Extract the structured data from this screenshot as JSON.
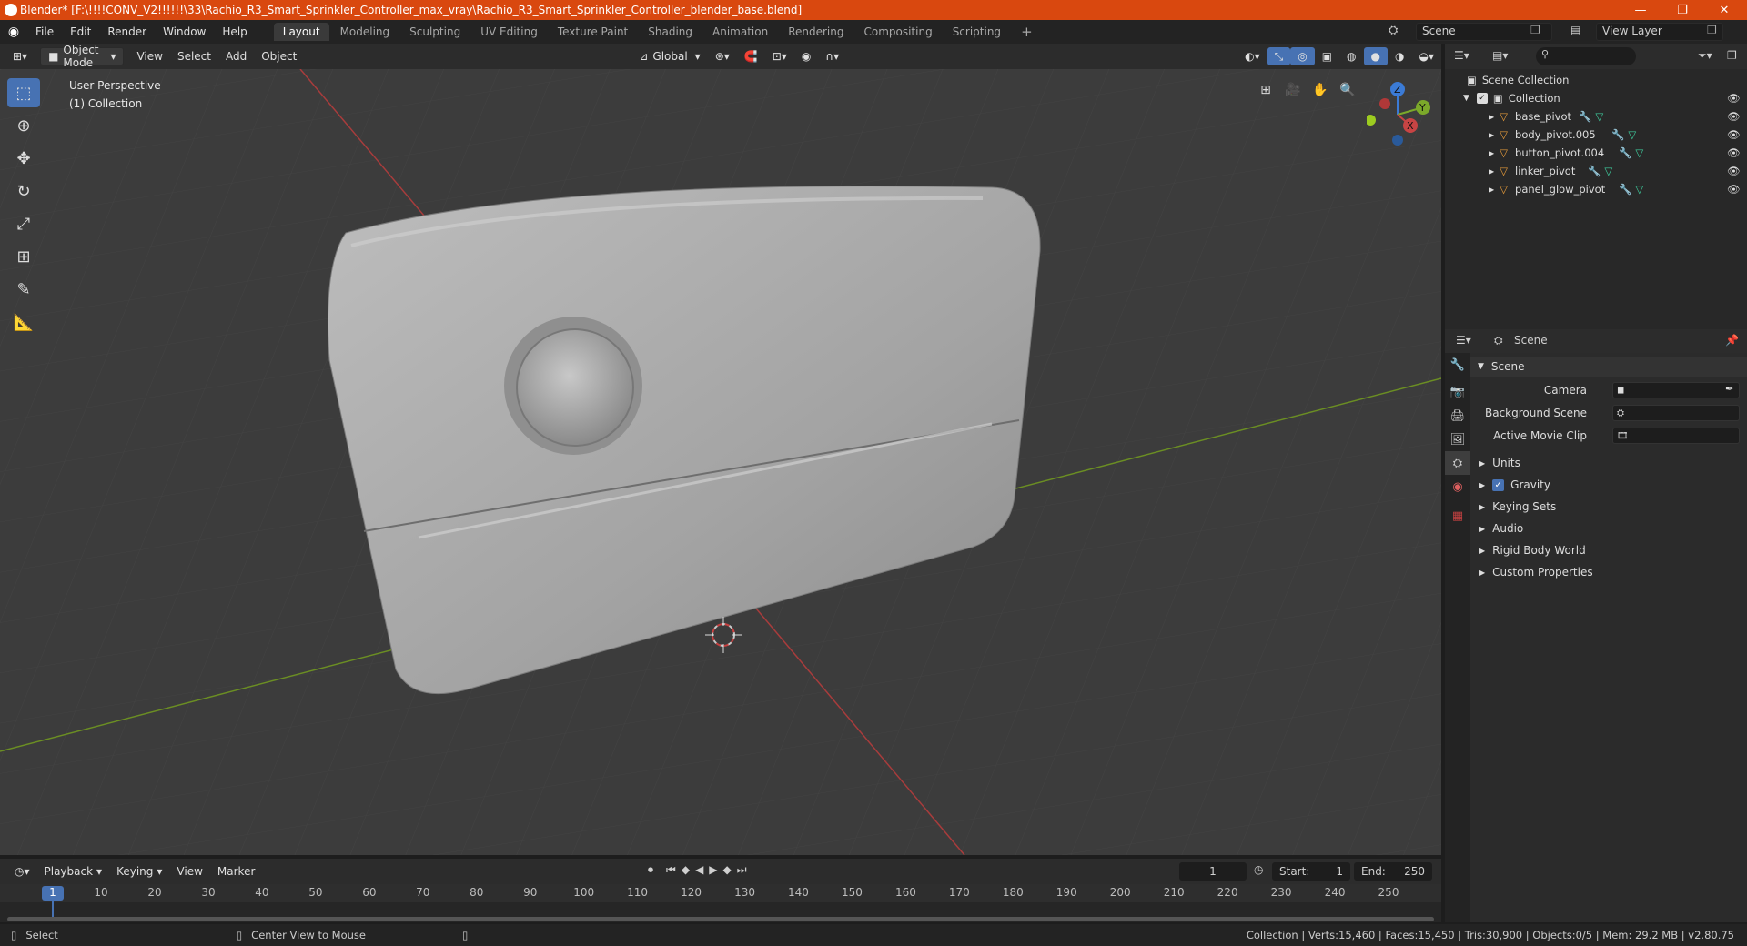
{
  "window": {
    "title": "Blender* [F:\\!!!!CONV_V2!!!!!!\\33\\Rachio_R3_Smart_Sprinkler_Controller_max_vray\\Rachio_R3_Smart_Sprinkler_Controller_blender_base.blend]",
    "minimize": "—",
    "restore": "❐",
    "close": "✕"
  },
  "menus": [
    "File",
    "Edit",
    "Render",
    "Window",
    "Help"
  ],
  "workspaces": [
    "Layout",
    "Modeling",
    "Sculpting",
    "UV Editing",
    "Texture Paint",
    "Shading",
    "Animation",
    "Rendering",
    "Compositing",
    "Scripting"
  ],
  "active_workspace": "Layout",
  "add_workspace": "+",
  "scene_selector": "Scene",
  "view_layer_selector": "View Layer",
  "viewport_header": {
    "mode": "Object Mode",
    "menus": [
      "View",
      "Select",
      "Add",
      "Object"
    ],
    "transform_orientation": "Global"
  },
  "viewport": {
    "perspective_label": "User Perspective",
    "collection_label": "(1) Collection",
    "gizmo_axes": [
      "Z",
      "Y",
      "X"
    ]
  },
  "outliner": {
    "root": "Scene Collection",
    "collection": "Collection",
    "objects": [
      "base_pivot",
      "body_pivot.005",
      "button_pivot.004",
      "linker_pivot",
      "panel_glow_pivot"
    ]
  },
  "properties": {
    "header_title": "Scene",
    "panel_title": "Scene",
    "fields": [
      {
        "label": "Camera",
        "value": ""
      },
      {
        "label": "Background Scene",
        "value": ""
      },
      {
        "label": "Active Movie Clip",
        "value": ""
      }
    ],
    "sections": [
      "Units",
      "Gravity",
      "Keying Sets",
      "Audio",
      "Rigid Body World",
      "Custom Properties"
    ],
    "gravity_checked": true
  },
  "timeline": {
    "menus": [
      "Playback",
      "Keying",
      "View",
      "Marker"
    ],
    "current_frame": "1",
    "start_label": "Start:",
    "start": "1",
    "end_label": "End:",
    "end": "250",
    "ticks": [
      "1",
      "10",
      "20",
      "30",
      "40",
      "50",
      "60",
      "70",
      "80",
      "90",
      "100",
      "110",
      "120",
      "130",
      "140",
      "150",
      "160",
      "170",
      "180",
      "190",
      "200",
      "210",
      "220",
      "230",
      "240",
      "250"
    ]
  },
  "statusbar": {
    "select": "Select",
    "center_view": "Center View to Mouse",
    "stats": "Collection | Verts:15,460 | Faces:15,450 | Tris:30,900 | Objects:0/5 | Mem: 29.2 MB | v2.80.75"
  }
}
